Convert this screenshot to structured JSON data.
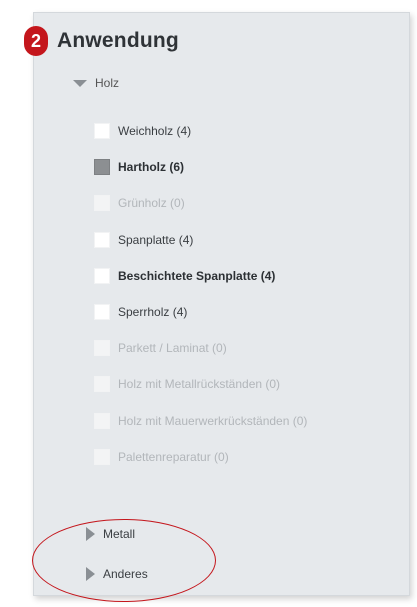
{
  "step_number": "2",
  "section_title": "Anwendung",
  "group": {
    "label": "Holz",
    "expanded": true
  },
  "items": [
    {
      "label": "Weichholz (4)",
      "checked": false,
      "bold": false,
      "disabled": false
    },
    {
      "label": "Hartholz (6)",
      "checked": true,
      "bold": true,
      "disabled": false
    },
    {
      "label": "Grünholz (0)",
      "checked": false,
      "bold": false,
      "disabled": true
    },
    {
      "label": "Spanplatte (4)",
      "checked": false,
      "bold": false,
      "disabled": false
    },
    {
      "label": "Beschichtete Spanplatte (4)",
      "checked": false,
      "bold": true,
      "disabled": false
    },
    {
      "label": "Sperrholz (4)",
      "checked": false,
      "bold": false,
      "disabled": false
    },
    {
      "label": "Parkett / Laminat (0)",
      "checked": false,
      "bold": false,
      "disabled": true
    },
    {
      "label": "Holz mit Metallrückständen (0)",
      "checked": false,
      "bold": false,
      "disabled": true
    },
    {
      "label": "Holz mit Mauerwerkrückständen (0)",
      "checked": false,
      "bold": false,
      "disabled": true
    },
    {
      "label": "Palettenreparatur (0)",
      "checked": false,
      "bold": false,
      "disabled": true
    }
  ],
  "collapsed_groups": [
    {
      "label": "Metall"
    },
    {
      "label": "Anderes"
    }
  ],
  "colors": {
    "panel_bg": "#e6e9ec",
    "accent_red": "#c4161c",
    "checked_box": "#8c8f92"
  }
}
